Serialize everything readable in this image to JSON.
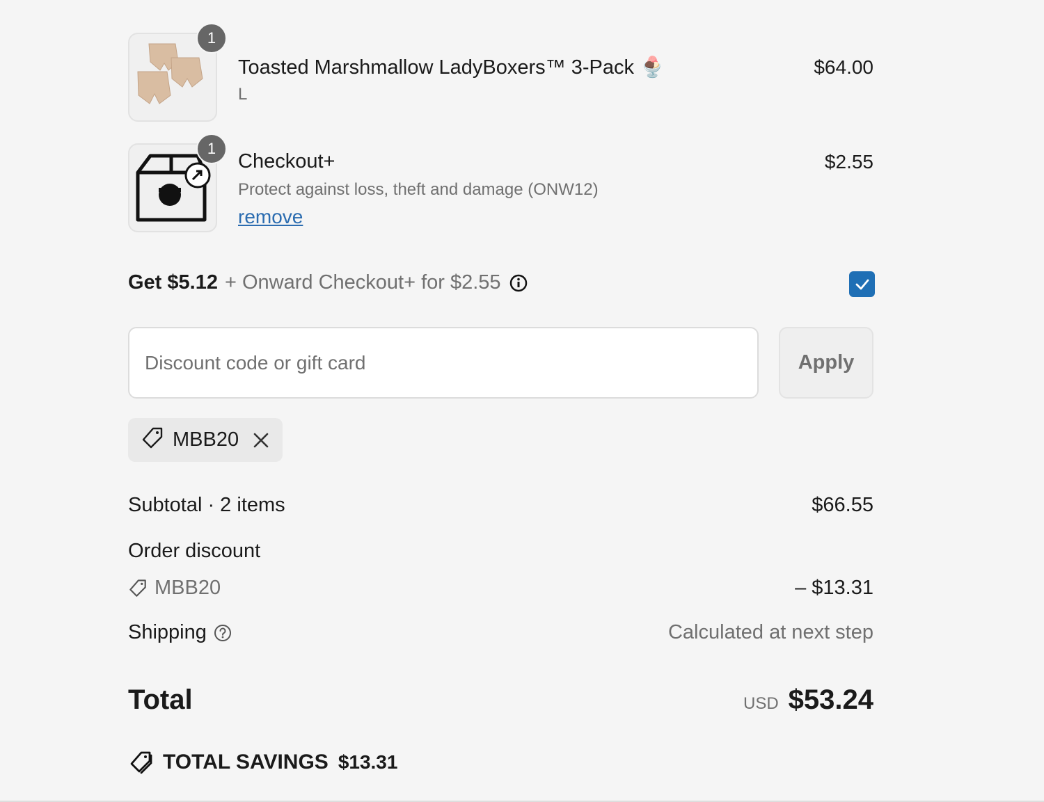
{
  "items": [
    {
      "quantity": "1",
      "name": "Toasted Marshmallow LadyBoxers™ 3-Pack 🍨",
      "variant": "L",
      "price": "$64.00"
    },
    {
      "quantity": "1",
      "name": "Checkout+",
      "description": "Protect against loss, theft and damage (ONW12)",
      "remove_label": "remove",
      "price": "$2.55"
    }
  ],
  "promo": {
    "bold": "Get $5.12",
    "rest": "+ Onward Checkout+ for $2.55",
    "checked": true,
    "accent": "#1f6fb5"
  },
  "discount": {
    "placeholder": "Discount code or gift card",
    "apply_label": "Apply",
    "applied_code": "MBB20"
  },
  "summary": {
    "subtotal_label": "Subtotal · 2 items",
    "subtotal_value": "$66.55",
    "order_discount_label": "Order discount",
    "discount_code": "MBB20",
    "discount_value": "– $13.31",
    "shipping_label": "Shipping",
    "shipping_value": "Calculated at next step",
    "total_label": "Total",
    "currency": "USD",
    "total_value": "$53.24",
    "savings_label": "TOTAL SAVINGS",
    "savings_value": "$13.31"
  },
  "icons": {
    "tag": "tag-icon",
    "info": "info-icon",
    "help": "question-circle-icon",
    "close": "close-icon",
    "check": "checkmark-icon",
    "savings_tags": "tags-icon"
  }
}
